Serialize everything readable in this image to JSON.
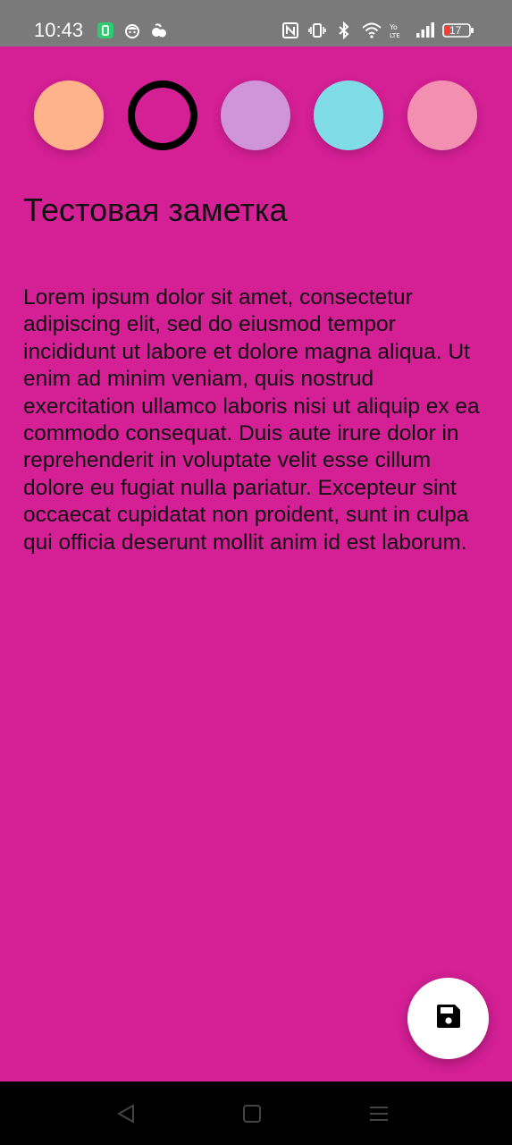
{
  "status_bar": {
    "time": "10:43",
    "left_icons": [
      "notification-app-icon",
      "robot-face-icon",
      "leaf-badge-icon"
    ],
    "right_icons": [
      "nfc-icon",
      "vibrate-icon",
      "bluetooth-icon",
      "wifi-icon",
      "volte-icon",
      "cellular-signal-icon",
      "battery-icon"
    ],
    "battery_level": "17"
  },
  "color_picker": {
    "colors": [
      "#ffb38a",
      "#d41f95",
      "#cf95d8",
      "#80dde8",
      "#f38fb1"
    ],
    "selected_index": 1,
    "selected_color": "#d41f95"
  },
  "note": {
    "title": "Тестовая заметка",
    "body": "Lorem ipsum dolor sit amet, consectetur adipiscing elit, sed do eiusmod tempor incididunt ut labore et dolore magna aliqua. Ut enim ad minim veniam, quis nostrud exercitation ullamco laboris nisi ut aliquip ex ea commodo consequat. Duis aute irure dolor in reprehenderit in voluptate velit esse cillum dolore eu fugiat nulla pariatur. Excepteur sint occaecat cupidatat non proident, sunt in culpa qui officia deserunt mollit anim id est laborum.",
    "background_color": "#d41f95"
  },
  "fab": {
    "icon": "save-icon"
  },
  "nav_bar": {
    "buttons": [
      "back-icon",
      "home-icon",
      "menu-icon"
    ]
  }
}
